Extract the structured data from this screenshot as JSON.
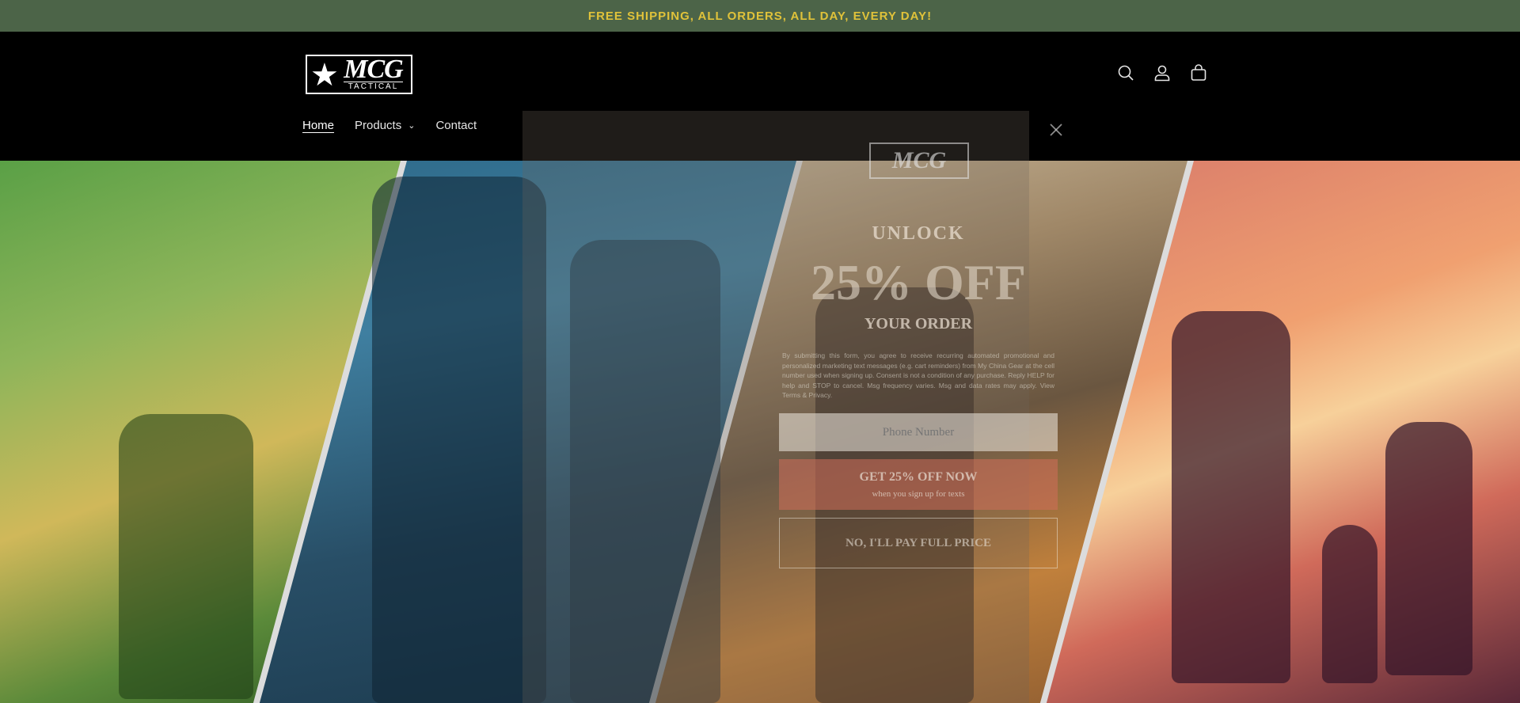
{
  "announcement": {
    "text": "FREE SHIPPING, ALL ORDERS, ALL DAY, EVERY DAY!"
  },
  "header": {
    "logo": {
      "main": "MCG",
      "sub": "TACTICAL",
      "icon": "star-icon"
    },
    "icons": [
      "search-icon",
      "account-icon",
      "cart-icon"
    ]
  },
  "nav": {
    "items": [
      {
        "label": "Home",
        "active": true
      },
      {
        "label": "Products",
        "has_dropdown": true
      },
      {
        "label": "Contact"
      }
    ]
  },
  "popup": {
    "logo_text": "MCG",
    "headline_top": "UNLOCK",
    "headline_main": "25% OFF",
    "headline_bottom": "YOUR ORDER",
    "legal": "By submitting this form, you agree to receive recurring automated promotional and personalized marketing text messages (e.g. cart reminders) from My China Gear at the cell number used when signing up. Consent is not a condition of any purchase. Reply HELP for help and STOP to cancel. Msg frequency varies. Msg and data rates may apply. View Terms & Privacy.",
    "phone_placeholder": "Phone Number",
    "cta_label": "GET 25% OFF NOW",
    "cta_sub": "when you sign up for texts",
    "decline_label": "NO, I'LL PAY FULL PRICE",
    "accent_color": "#d26e5a"
  }
}
